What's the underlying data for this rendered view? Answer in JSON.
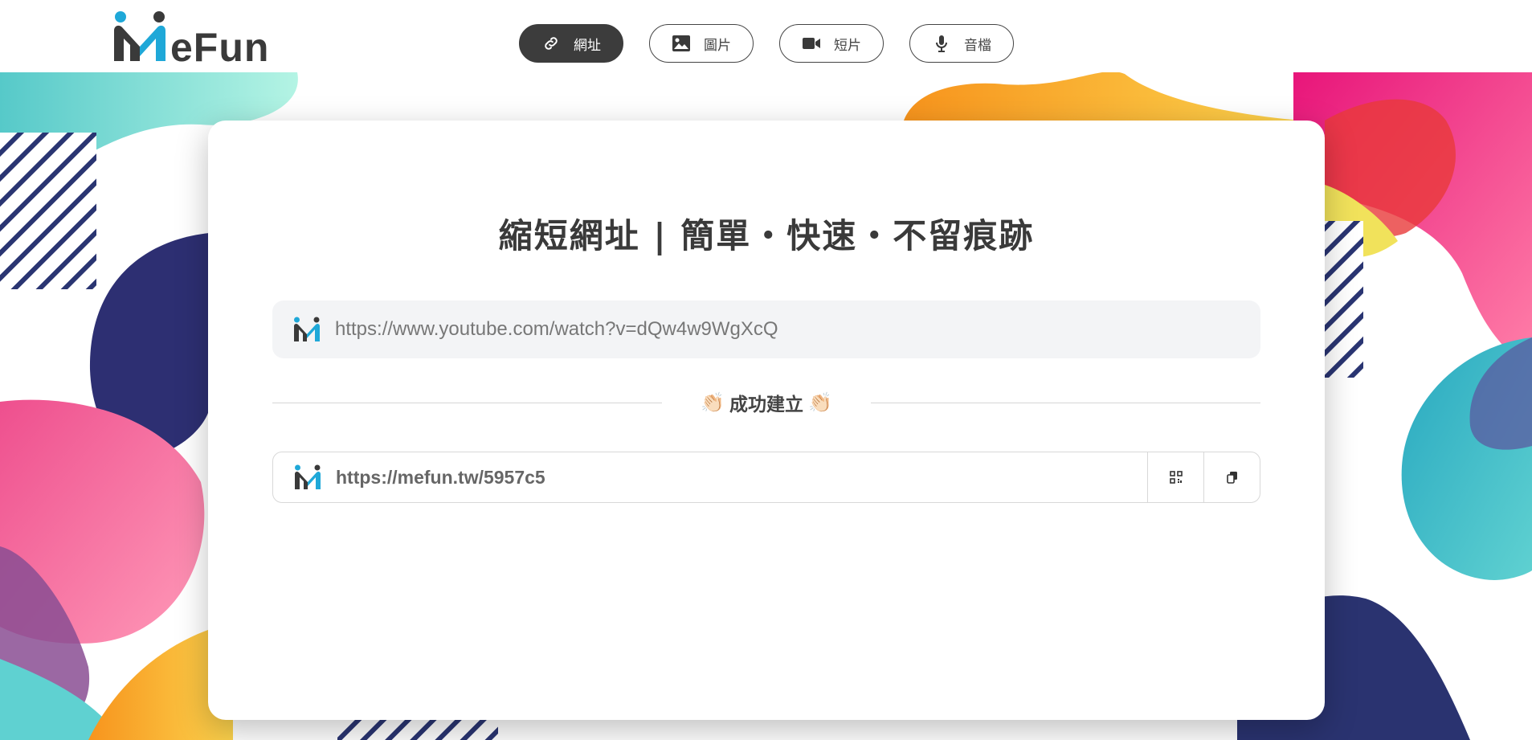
{
  "brand": {
    "logo_text": "eFun",
    "colors": {
      "accent": "#1fa8d8",
      "dark": "#3a3a3a"
    }
  },
  "nav": {
    "tabs": [
      {
        "label": "網址",
        "icon": "link-icon",
        "active": true
      },
      {
        "label": "圖片",
        "icon": "image-icon",
        "active": false
      },
      {
        "label": "短片",
        "icon": "video-icon",
        "active": false
      },
      {
        "label": "音檔",
        "icon": "microphone-icon",
        "active": false
      }
    ]
  },
  "main": {
    "title": "縮短網址 | 簡單・快速・不留痕跡",
    "input": {
      "value": "https://www.youtube.com/watch?v=dQw4w9WgXcQ"
    },
    "success": {
      "label": "成功建立",
      "emoji": "👏🏻"
    },
    "result": {
      "short_url": "https://mefun.tw/5957c5",
      "qr_icon": "qrcode-icon",
      "copy_icon": "copy-icon"
    }
  }
}
